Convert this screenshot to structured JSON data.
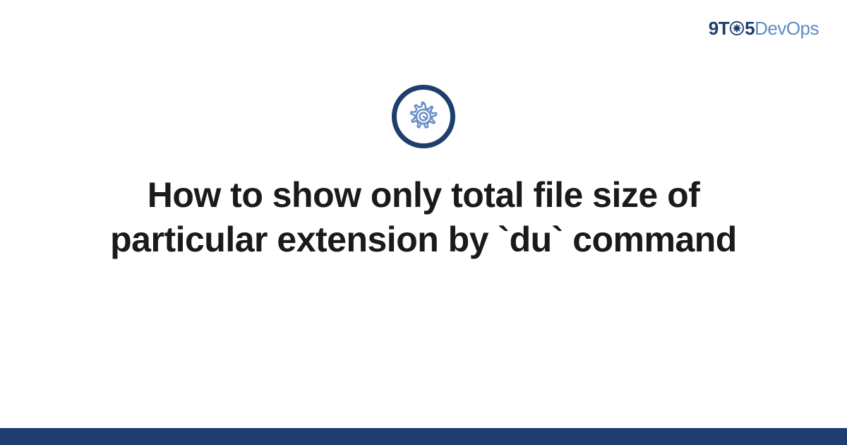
{
  "logo": {
    "part1": "9T",
    "part2": "5",
    "part3": "DevOps",
    "icon": "gear-icon"
  },
  "main": {
    "icon": "gear-icon",
    "title": "How to show only total file size of particular extension by `du` command"
  },
  "colors": {
    "brand_dark": "#1d3e6e",
    "brand_light": "#5b8bc4",
    "icon_accent": "#6b8fc7"
  }
}
